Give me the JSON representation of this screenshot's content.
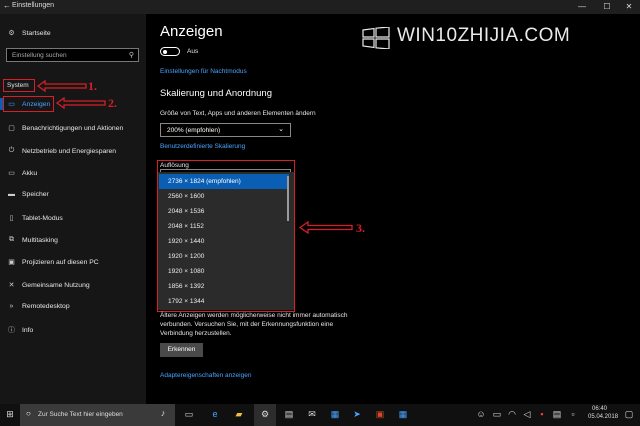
{
  "window": {
    "title": "Einstellungen",
    "min": "—",
    "max": "☐",
    "close": "✕"
  },
  "sidebar": {
    "home": "Startseite",
    "search_placeholder": "Einstellung suchen",
    "section": "System",
    "items": [
      {
        "label": "Anzeigen",
        "icon": "monitor-icon"
      },
      {
        "label": "Benachrichtigungen und Aktionen",
        "icon": "notification-icon"
      },
      {
        "label": "Netzbetrieb und Energiesparen",
        "icon": "power-icon"
      },
      {
        "label": "Akku",
        "icon": "battery-icon"
      },
      {
        "label": "Speicher",
        "icon": "storage-icon"
      },
      {
        "label": "Tablet-Modus",
        "icon": "tablet-icon"
      },
      {
        "label": "Multitasking",
        "icon": "multitasking-icon"
      },
      {
        "label": "Projizieren auf diesen PC",
        "icon": "project-icon"
      },
      {
        "label": "Gemeinsame Nutzung",
        "icon": "share-icon"
      },
      {
        "label": "Remotedesktop",
        "icon": "remote-icon"
      },
      {
        "label": "Info",
        "icon": "info-icon"
      }
    ]
  },
  "annotations": {
    "a1": "1.",
    "a2": "2.",
    "a3": "3."
  },
  "main": {
    "title": "Anzeigen",
    "toggle_label": "Aus",
    "night_link": "Einstellungen für Nachtmodus",
    "section": "Skalierung und Anordnung",
    "scale_label": "Größe von Text, Apps und anderen Elementen ändern",
    "scale_value": "200% (empfohlen)",
    "custom_scale_link": "Benutzerdefinierte Skalierung",
    "resolution_label": "Auflösung",
    "resolutions": [
      "2736 × 1824 (empfohlen)",
      "2560 × 1600",
      "2048 × 1536",
      "2048 × 1152",
      "1920 × 1440",
      "1920 × 1200",
      "1920 × 1080",
      "1856 × 1392",
      "1792 × 1344"
    ],
    "selected_resolution_index": 0,
    "note_line1": "Ältere Anzeigen werden möglicherweise nicht immer automatisch",
    "note_line2": "verbunden. Versuchen Sie, mit der Erkennungsfunktion eine",
    "note_line3": "Verbindung herzustellen.",
    "detect_button": "Erkennen",
    "adapter_link": "Adaptereigenschaften anzeigen"
  },
  "watermark": "WIN10ZHIJIA.COM",
  "taskbar": {
    "search_placeholder": "Zur Suche Text hier eingeben",
    "time": "06:40",
    "date": "05.04.2018"
  },
  "colors": {
    "accent": "#0a5fb4",
    "link": "#4aa3ff",
    "annotation": "#d61f26"
  }
}
